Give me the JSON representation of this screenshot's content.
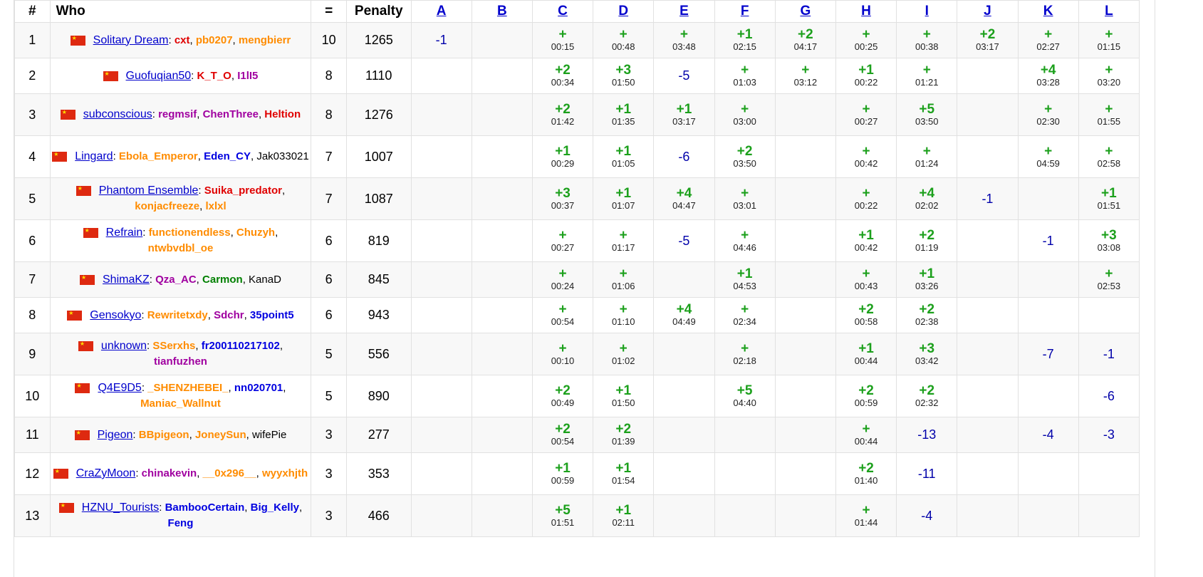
{
  "header": {
    "rank": "#",
    "who": "Who",
    "solved": "=",
    "penalty": "Penalty",
    "problems": [
      "A",
      "B",
      "C",
      "D",
      "E",
      "F",
      "G",
      "H",
      "I",
      "J",
      "K",
      "L"
    ]
  },
  "rows": [
    {
      "rank": "1",
      "team": "Solitary Dream",
      "solved": "10",
      "penalty": "1265",
      "members": [
        {
          "name": "cxt",
          "color": "red"
        },
        {
          "name": "pb0207",
          "color": "orange"
        },
        {
          "name": "mengbierr",
          "color": "orange"
        }
      ],
      "cells": [
        {
          "v": "-1"
        },
        {},
        {
          "v": "+",
          "t": "00:15"
        },
        {
          "v": "+",
          "t": "00:48"
        },
        {
          "v": "+",
          "t": "03:48"
        },
        {
          "v": "+1",
          "t": "02:15"
        },
        {
          "v": "+2",
          "t": "04:17"
        },
        {
          "v": "+",
          "t": "00:25"
        },
        {
          "v": "+",
          "t": "00:38"
        },
        {
          "v": "+2",
          "t": "03:17"
        },
        {
          "v": "+",
          "t": "02:27"
        },
        {
          "v": "+",
          "t": "01:15"
        }
      ]
    },
    {
      "rank": "2",
      "team": "Guofuqian50",
      "solved": "8",
      "penalty": "1110",
      "members": [
        {
          "name": "K_T_O",
          "color": "red"
        },
        {
          "name": "I1lI5",
          "color": "violet"
        }
      ],
      "cells": [
        {},
        {},
        {
          "v": "+2",
          "t": "00:34"
        },
        {
          "v": "+3",
          "t": "01:50"
        },
        {
          "v": "-5"
        },
        {
          "v": "+",
          "t": "01:03"
        },
        {
          "v": "+",
          "t": "03:12"
        },
        {
          "v": "+1",
          "t": "00:22"
        },
        {
          "v": "+",
          "t": "01:21"
        },
        {},
        {
          "v": "+4",
          "t": "03:28"
        },
        {
          "v": "+",
          "t": "03:20"
        }
      ]
    },
    {
      "rank": "3",
      "team": "subconscious",
      "solved": "8",
      "penalty": "1276",
      "members": [
        {
          "name": "regmsif",
          "color": "violet"
        },
        {
          "name": "ChenThree",
          "color": "violet"
        },
        {
          "name": "Heltion",
          "color": "red"
        }
      ],
      "cells": [
        {},
        {},
        {
          "v": "+2",
          "t": "01:42"
        },
        {
          "v": "+1",
          "t": "01:35"
        },
        {
          "v": "+1",
          "t": "03:17"
        },
        {
          "v": "+",
          "t": "03:00"
        },
        {},
        {
          "v": "+",
          "t": "00:27"
        },
        {
          "v": "+5",
          "t": "03:50"
        },
        {},
        {
          "v": "+",
          "t": "02:30"
        },
        {
          "v": "+",
          "t": "01:55"
        }
      ]
    },
    {
      "rank": "4",
      "team": "Lingard",
      "solved": "7",
      "penalty": "1007",
      "members": [
        {
          "name": "Ebola_Emperor",
          "color": "orange"
        },
        {
          "name": "Eden_CY",
          "color": "blue"
        },
        {
          "name": "Jak033021",
          "color": "black"
        }
      ],
      "cells": [
        {},
        {},
        {
          "v": "+1",
          "t": "00:29"
        },
        {
          "v": "+1",
          "t": "01:05"
        },
        {
          "v": "-6"
        },
        {
          "v": "+2",
          "t": "03:50"
        },
        {},
        {
          "v": "+",
          "t": "00:42"
        },
        {
          "v": "+",
          "t": "01:24"
        },
        {},
        {
          "v": "+",
          "t": "04:59"
        },
        {
          "v": "+",
          "t": "02:58"
        }
      ]
    },
    {
      "rank": "5",
      "team": "Phantom Ensemble",
      "solved": "7",
      "penalty": "1087",
      "members": [
        {
          "name": "Suika_predator",
          "color": "red"
        },
        {
          "name": "konjacfreeze",
          "color": "orange"
        },
        {
          "name": "lxlxl",
          "color": "orange"
        }
      ],
      "cells": [
        {},
        {},
        {
          "v": "+3",
          "t": "00:37"
        },
        {
          "v": "+1",
          "t": "01:07"
        },
        {
          "v": "+4",
          "t": "04:47"
        },
        {
          "v": "+",
          "t": "03:01"
        },
        {},
        {
          "v": "+",
          "t": "00:22"
        },
        {
          "v": "+4",
          "t": "02:02"
        },
        {
          "v": "-1"
        },
        {},
        {
          "v": "+1",
          "t": "01:51"
        }
      ]
    },
    {
      "rank": "6",
      "team": "Refrain",
      "solved": "6",
      "penalty": "819",
      "members": [
        {
          "name": "functionendless",
          "color": "orange"
        },
        {
          "name": "Chuzyh",
          "color": "orange"
        },
        {
          "name": "ntwbvdbl_oe",
          "color": "orange"
        }
      ],
      "cells": [
        {},
        {},
        {
          "v": "+",
          "t": "00:27"
        },
        {
          "v": "+",
          "t": "01:17"
        },
        {
          "v": "-5"
        },
        {
          "v": "+",
          "t": "04:46"
        },
        {},
        {
          "v": "+1",
          "t": "00:42"
        },
        {
          "v": "+2",
          "t": "01:19"
        },
        {},
        {
          "v": "-1"
        },
        {
          "v": "+3",
          "t": "03:08"
        }
      ]
    },
    {
      "rank": "7",
      "team": "ShimaKZ",
      "solved": "6",
      "penalty": "845",
      "members": [
        {
          "name": "Qza_AC",
          "color": "violet"
        },
        {
          "name": "Carmon",
          "color": "green"
        },
        {
          "name": "KanaD",
          "color": "black"
        }
      ],
      "cells": [
        {},
        {},
        {
          "v": "+",
          "t": "00:24"
        },
        {
          "v": "+",
          "t": "01:06"
        },
        {},
        {
          "v": "+1",
          "t": "04:53"
        },
        {},
        {
          "v": "+",
          "t": "00:43"
        },
        {
          "v": "+1",
          "t": "03:26"
        },
        {},
        {},
        {
          "v": "+",
          "t": "02:53"
        }
      ]
    },
    {
      "rank": "8",
      "team": "Gensokyo",
      "solved": "6",
      "penalty": "943",
      "members": [
        {
          "name": "Rewritetxdy",
          "color": "orange"
        },
        {
          "name": "Sdchr",
          "color": "violet"
        },
        {
          "name": "35point5",
          "color": "blue"
        }
      ],
      "cells": [
        {},
        {},
        {
          "v": "+",
          "t": "00:54"
        },
        {
          "v": "+",
          "t": "01:10"
        },
        {
          "v": "+4",
          "t": "04:49"
        },
        {
          "v": "+",
          "t": "02:34"
        },
        {},
        {
          "v": "+2",
          "t": "00:58"
        },
        {
          "v": "+2",
          "t": "02:38"
        },
        {},
        {},
        {}
      ]
    },
    {
      "rank": "9",
      "team": "unknown",
      "solved": "5",
      "penalty": "556",
      "members": [
        {
          "name": "SSerxhs",
          "color": "orange"
        },
        {
          "name": "fr200110217102",
          "color": "blue"
        },
        {
          "name": "tianfuzhen",
          "color": "violet"
        }
      ],
      "cells": [
        {},
        {},
        {
          "v": "+",
          "t": "00:10"
        },
        {
          "v": "+",
          "t": "01:02"
        },
        {},
        {
          "v": "+",
          "t": "02:18"
        },
        {},
        {
          "v": "+1",
          "t": "00:44"
        },
        {
          "v": "+3",
          "t": "03:42"
        },
        {},
        {
          "v": "-7"
        },
        {
          "v": "-1"
        }
      ]
    },
    {
      "rank": "10",
      "team": "Q4E9D5",
      "solved": "5",
      "penalty": "890",
      "members": [
        {
          "name": "_SHENZHEBEI_",
          "color": "orange"
        },
        {
          "name": "nn020701",
          "color": "blue"
        },
        {
          "name": "Maniac_Wallnut",
          "color": "orange"
        }
      ],
      "cells": [
        {},
        {},
        {
          "v": "+2",
          "t": "00:49"
        },
        {
          "v": "+1",
          "t": "01:50"
        },
        {},
        {
          "v": "+5",
          "t": "04:40"
        },
        {},
        {
          "v": "+2",
          "t": "00:59"
        },
        {
          "v": "+2",
          "t": "02:32"
        },
        {},
        {},
        {
          "v": "-6"
        }
      ]
    },
    {
      "rank": "11",
      "team": "Pigeon",
      "solved": "3",
      "penalty": "277",
      "members": [
        {
          "name": "BBpigeon",
          "color": "orange"
        },
        {
          "name": "JoneySun",
          "color": "orange"
        },
        {
          "name": "wifePie",
          "color": "black"
        }
      ],
      "cells": [
        {},
        {},
        {
          "v": "+2",
          "t": "00:54"
        },
        {
          "v": "+2",
          "t": "01:39"
        },
        {},
        {},
        {},
        {
          "v": "+",
          "t": "00:44"
        },
        {
          "v": "-13"
        },
        {},
        {
          "v": "-4"
        },
        {
          "v": "-3"
        }
      ]
    },
    {
      "rank": "12",
      "team": "CraZyMoon",
      "solved": "3",
      "penalty": "353",
      "members": [
        {
          "name": "chinakevin",
          "color": "violet"
        },
        {
          "name": "__0x296__",
          "color": "orange"
        },
        {
          "name": "wyyxhjth",
          "color": "orange"
        }
      ],
      "cells": [
        {},
        {},
        {
          "v": "+1",
          "t": "00:59"
        },
        {
          "v": "+1",
          "t": "01:54"
        },
        {},
        {},
        {},
        {
          "v": "+2",
          "t": "01:40"
        },
        {
          "v": "-11"
        },
        {},
        {},
        {}
      ]
    },
    {
      "rank": "13",
      "team": "HZNU_Tourists",
      "solved": "3",
      "penalty": "466",
      "members": [
        {
          "name": "BambooCertain",
          "color": "blue"
        },
        {
          "name": "Big_Kelly",
          "color": "blue"
        },
        {
          "name": "Feng",
          "color": "blue"
        }
      ],
      "cells": [
        {},
        {},
        {
          "v": "+5",
          "t": "01:51"
        },
        {
          "v": "+1",
          "t": "02:11"
        },
        {},
        {},
        {},
        {
          "v": "+",
          "t": "01:44"
        },
        {
          "v": "-4"
        },
        {},
        {},
        {}
      ]
    }
  ]
}
